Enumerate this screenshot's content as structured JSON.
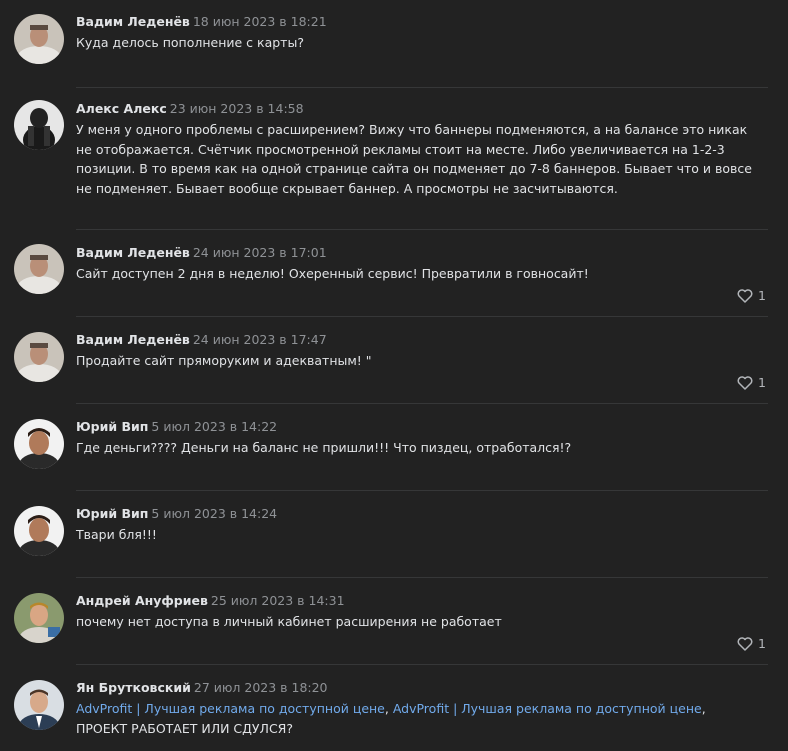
{
  "comments": [
    {
      "author": "Вадим Леденёв",
      "date": "18 июн 2023 в 18:21",
      "text": "Куда делось пополнение с карты?",
      "avatar": "avatar-vadim",
      "likes": ""
    },
    {
      "author": "Алекс Алекс",
      "date": "23 июн 2023 в 14:58",
      "text": "У меня у одного проблемы с расширением? Вижу что баннеры подменяются, а на балансе это никак не отображается. Счётчик просмотренной рекламы стоит на месте. Либо увеличивается на 1-2-3 позиции. В то время как на одной странице сайта он подменяет до 7-8 баннеров. Бывает что и вовсе не подменяет. Бывает вообще скрывает баннер. А просмотры не засчитываются.",
      "avatar": "avatar-aleks",
      "likes": ""
    },
    {
      "author": "Вадим Леденёв",
      "date": "24 июн 2023 в 17:01",
      "text": "Сайт доступен 2 дня в неделю! Охеренный сервис! Превратили в говносайт!",
      "avatar": "avatar-vadim",
      "likes": "1"
    },
    {
      "author": "Вадим Леденёв",
      "date": "24 июн 2023 в 17:47",
      "text": "Продайте сайт пряморуким и адекватным! \"",
      "avatar": "avatar-vadim",
      "likes": "1"
    },
    {
      "author": "Юрий Вип",
      "date": "5 июл 2023 в 14:22",
      "text": "Где деньги???? Деньги на баланс не пришли!!! Что пиздец, отработался!?",
      "avatar": "avatar-yuri",
      "likes": ""
    },
    {
      "author": "Юрий Вип",
      "date": "5 июл 2023 в 14:24",
      "text": "Твари бля!!!",
      "avatar": "avatar-yuri",
      "likes": ""
    },
    {
      "author": "Андрей Ануфриев",
      "date": "25 июл 2023 в 14:31",
      "text": "почему нет доступа в личный кабинет расширения не работает",
      "avatar": "avatar-andrey",
      "likes": "1"
    },
    {
      "author": "Ян Брутковский",
      "date": "27 июл 2023 в 18:20",
      "link1": "AdvProfit | Лучшая реклама по доступной цене",
      "sep": ", ",
      "link2": "AdvProfit | Лучшая реклама по доступной цене",
      "text_rest": ", ПРОЕКТ РАБОТАЕТ ИЛИ СДУЛСЯ?",
      "avatar": "avatar-yan",
      "likes": ""
    }
  ],
  "colors": {
    "background": "#222222",
    "text": "#e1e3e6",
    "date": "#8f9296",
    "link": "#71aaeb",
    "divider": "#363738"
  }
}
